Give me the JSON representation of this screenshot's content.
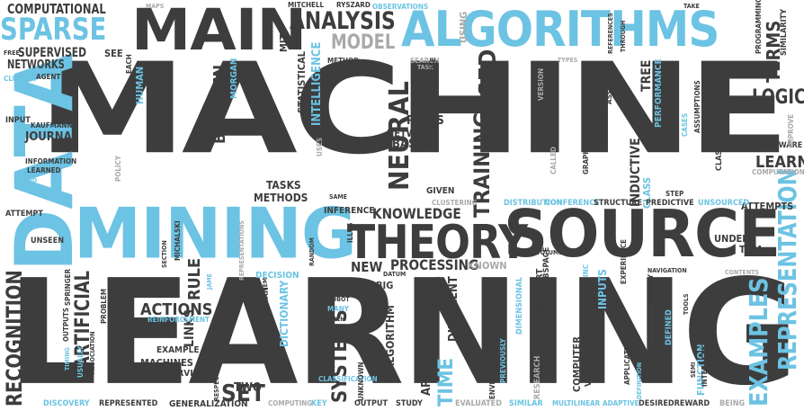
{
  "colors": {
    "dark": "#3d3d3d",
    "blue": "#6cc3e3",
    "gray": "#a9a9a9",
    "background": "#ffffff"
  },
  "words": {
    "machine": "MACHINE",
    "learning": "LEARNING",
    "data": "DATA",
    "mining": "MINING",
    "source": "SOURCE",
    "main": "MAIN",
    "algorithms": "ALGORITHMS",
    "sparse": "SPARSE",
    "theory": "THEORY",
    "computational": "COMPUTATIONAL",
    "analysis": "ANALYSIS",
    "model": "MODEL",
    "supervised": "SUPERVISED",
    "networks": "NETWORKS",
    "neural": "NEURAL",
    "training": "TRAINING",
    "used": "USED",
    "logic": "LOGIC",
    "learn": "LEARN",
    "terms": "TERMS",
    "representation": "REPRESENTATION",
    "examples": "EXAMPLES",
    "recognition": "RECOGNITION",
    "artificial": "ARTIFICIAL",
    "actions": "ACTIONS",
    "processing": "PROCESSING",
    "knowledge": "KNOWLEDGE",
    "new": "NEW",
    "set": "SET",
    "two": "TWO",
    "systems": "SYSTEMS",
    "time": "TIME",
    "journal": "JOURNAL",
    "between": "BETWEEN",
    "press_network_based": "PRESS",
    "network": "NETWORK",
    "based": "BASED",
    "intelligence": "INTELLIGENCE",
    "statistical": "STATISTICAL",
    "human": "HUMAN",
    "inference": "INFERENCE",
    "generalization": "GENERALIZATION",
    "machines": "MACHINES",
    "unsupervised": "UNSUPERVISED",
    "example": "EXAMPLE",
    "rule": "RULE",
    "links": "LINKS",
    "tasks": "TASKS",
    "methods": "METHODS",
    "attempts": "ATTEMPTS",
    "under": "UNDER",
    "tom": "TOM",
    "software": "SOFTWARE",
    "classes": "CLASSES",
    "computation": "COMPUTATION",
    "pattern": "PATTERN",
    "algorithm": "ALGORITHM",
    "approach": "APPROACH",
    "different": "DIFFERENT",
    "big": "BIG",
    "known": "KNOWN",
    "decision": "DECISION",
    "dictionary": "DICTIONARY",
    "bayesian": "BAYESIAN",
    "reinforcement": "REINFORCEMENT",
    "discovery": "DISCOVERY",
    "represented": "REPRESENTED",
    "output": "OUTPUT",
    "study": "STUDY",
    "evaluated": "EVALUATED",
    "similar": "SIMILAR",
    "adaptive": "ADAPTIVE",
    "desiredreward": "DESIREDREWARD",
    "being": "BEING",
    "computing": "COMPUTING",
    "key": "KEY",
    "inductive": "INDUCTIVE",
    "class": "CLASS",
    "tree": "TREE",
    "performance": "PERFORMANCE",
    "given": "GIVEN",
    "clustering": "CLUSTERING",
    "distribution": "DISTRIBUTION",
    "conference": "CONFERENCE",
    "structure": "STRUCTURE",
    "predictive": "PREDICTIVE",
    "unsourced": "UNSOURCED",
    "subspace": "SUBSPACE",
    "unseen": "UNSEEN",
    "attempt": "ATTEMPT",
    "information": "INFORMATION",
    "learned": "LEARNED",
    "input": "INPUT",
    "kaufmann": "KAUFMANN",
    "cluster": "CLUSTER",
    "agent": "AGENT",
    "mitchell": "MITCHELL",
    "ryszard": "RYSZARD",
    "mit": "MIT",
    "method": "METHOD",
    "search": "SEARCH",
    "using": "USING",
    "generalise": "GENERALISE",
    "programming": "PROGRAMMING",
    "similarity": "SIMILARITY",
    "take": "TAKE",
    "references": "REFERENCES",
    "through": "THROUGH",
    "types": "TYPES",
    "free": "FREE",
    "see": "SEE",
    "each": "EACH",
    "morgan": "MORGAN",
    "observations": "OBSERVATIONS",
    "maps": "MAPS",
    "one": "ONE",
    "uses": "USES",
    "task": "TASK",
    "variables": "VARIABLES",
    "called": "CALLED",
    "graphical": "GRAPHICAL",
    "observed": "OBSERVED",
    "assumed": "ASSUMED",
    "version": "VERSION",
    "cases": "CASES",
    "assumptions": "ASSUMPTIONS",
    "improve": "IMPROVE",
    "step": "STEP",
    "inputs": "INPUTS",
    "inc": "INC",
    "experience": "EXPERIENCE",
    "navigation": "NAVIGATION",
    "ability": "ABILITY",
    "applications": "APPLICATIONS",
    "tools": "TOOLS",
    "defined": "DEFINED",
    "function": "FUNCTION",
    "metric": "METRIC",
    "contents": "CONTENTS",
    "semi": "SEMI",
    "interaction": "INTERACTION",
    "definition": "DEFINITION",
    "vector": "VECTOR",
    "computer": "COMPUTER",
    "research": "RESEARCH",
    "support": "SUPPORT",
    "environment": "ENVIRONMENT",
    "previously": "PREVIOUSLY",
    "dimensional": "DIMENSIONAL",
    "multilinear": "MULTILINEAR",
    "many": "MANY",
    "classification": "CLASSIFICATION",
    "robot": "ROBOT",
    "such": "SUCH",
    "datum": "DATUM",
    "language": "LANGUAGE",
    "unknown": "UNKNOWN",
    "volume": "VOLUME",
    "random": "RANDOM",
    "illus": "ILLUS",
    "use": "USE",
    "section": "SECTION",
    "michalski": "MICHALSKI",
    "representations": "REPRESENTATIONS",
    "item": "ITEM",
    "respect": "RESPECT",
    "policy": "POLICY",
    "usually": "USUALLY",
    "association": "ASSOCIATION",
    "problem": "PROBLEM",
    "outputs": "OUTPUTS",
    "springer": "SPRINGER",
    "timing": "TIMING",
    "same": "SAME",
    "find": "FIND",
    "rules": "RULES",
    "jame": "JAME"
  }
}
